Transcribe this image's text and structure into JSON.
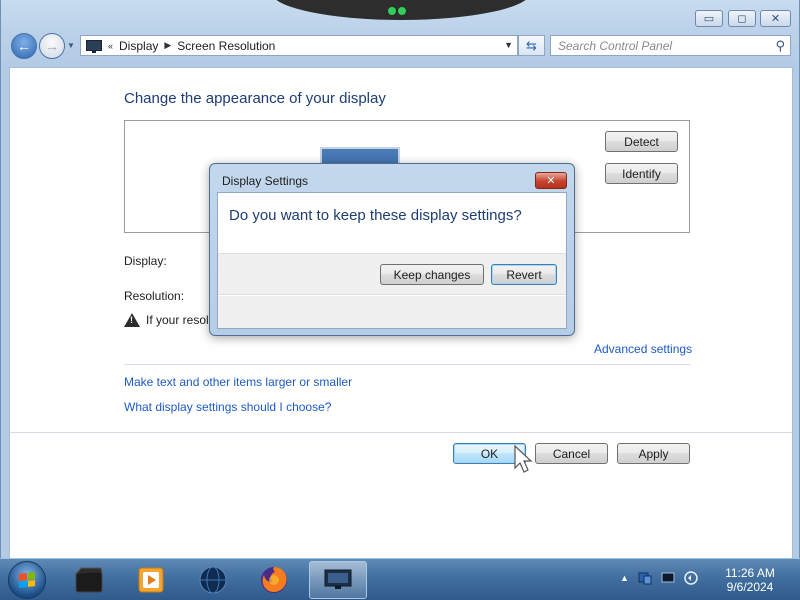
{
  "window": {
    "controls": {
      "minimize": "▭",
      "maximize": "◻",
      "close": "✕"
    }
  },
  "nav": {
    "back_icon": "←",
    "forward_icon": "→",
    "breadcrumb_overflow": "«",
    "breadcrumbs": [
      "Display",
      "Screen Resolution"
    ],
    "search_placeholder": "Search Control Panel",
    "refresh_icon": "⇆",
    "search_icon": "⚲"
  },
  "main": {
    "title": "Change the appearance of your display",
    "detect_label": "Detect",
    "identify_label": "Identify",
    "display_label": "Display:",
    "resolution_label": "Resolution:",
    "warning_text": "If your resolu",
    "advanced_link": "Advanced settings",
    "text_size_link": "Make text and other items larger or smaller",
    "which_settings_link": "What display settings should I choose?",
    "ok_label": "OK",
    "cancel_label": "Cancel",
    "apply_label": "Apply"
  },
  "dialog": {
    "title": "Display Settings",
    "message": "Do you want to keep these display settings?",
    "keep_label": "Keep changes",
    "revert_label": "Revert",
    "close_icon": "✕"
  },
  "taskbar": {
    "items": [
      "explorer-icon",
      "media-player-icon",
      "globe-icon",
      "firefox-icon",
      "display-settings-icon"
    ],
    "clock_time": "11:26 AM",
    "clock_date": "9/6/2024",
    "tray_chevron": "▲"
  },
  "colors": {
    "title_blue": "#1e3d74",
    "link_blue": "#1e5ac8",
    "frame_blue": "#b4cbe6",
    "taskbar_blue": "#416f9f"
  }
}
